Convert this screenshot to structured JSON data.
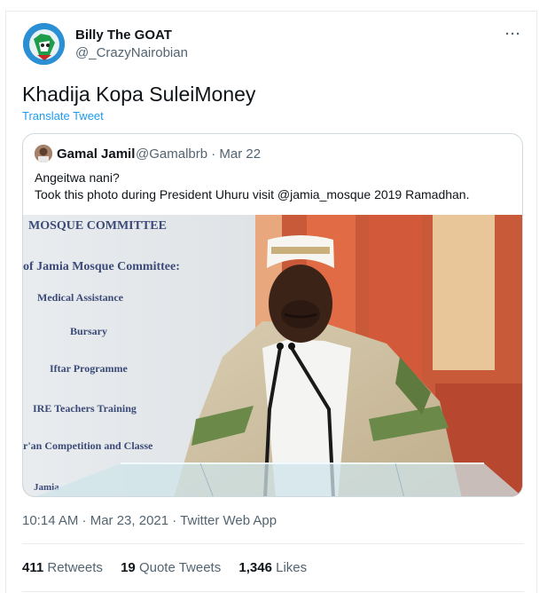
{
  "author": {
    "name": "Billy The GOAT",
    "handle": "@_CrazyNairobian"
  },
  "more_icon": "more-horizontal-icon",
  "tweet": {
    "text": "Khadija Kopa SuleiMoney",
    "translate_label": "Translate Tweet"
  },
  "quoted": {
    "name": "Gamal Jamil",
    "meta": "@Gamalbrb · Mar 22",
    "line1": "Angeitwa nani?",
    "line2": "Took this photo during President Uhuru visit @jamia_mosque 2019 Ramadhan.",
    "photo_banner": [
      "MOSQUE COMMITTEE",
      "of Jamia Mosque Committee:",
      "Medical Assistance",
      "Bursary",
      "Iftar Programme",
      "IRE Teachers Training",
      "r'an Competition and Classe",
      "Jamia"
    ]
  },
  "timestamp": "10:14 AM · Mar 23, 2021 · Twitter Web App",
  "stats": {
    "retweets_count": "411",
    "retweets_label": "Retweets",
    "quotes_count": "19",
    "quotes_label": "Quote Tweets",
    "likes_count": "1,346",
    "likes_label": "Likes"
  },
  "colors": {
    "link": "#1d9bf0",
    "secondary_text": "#536471",
    "border": "#cfd9de"
  }
}
